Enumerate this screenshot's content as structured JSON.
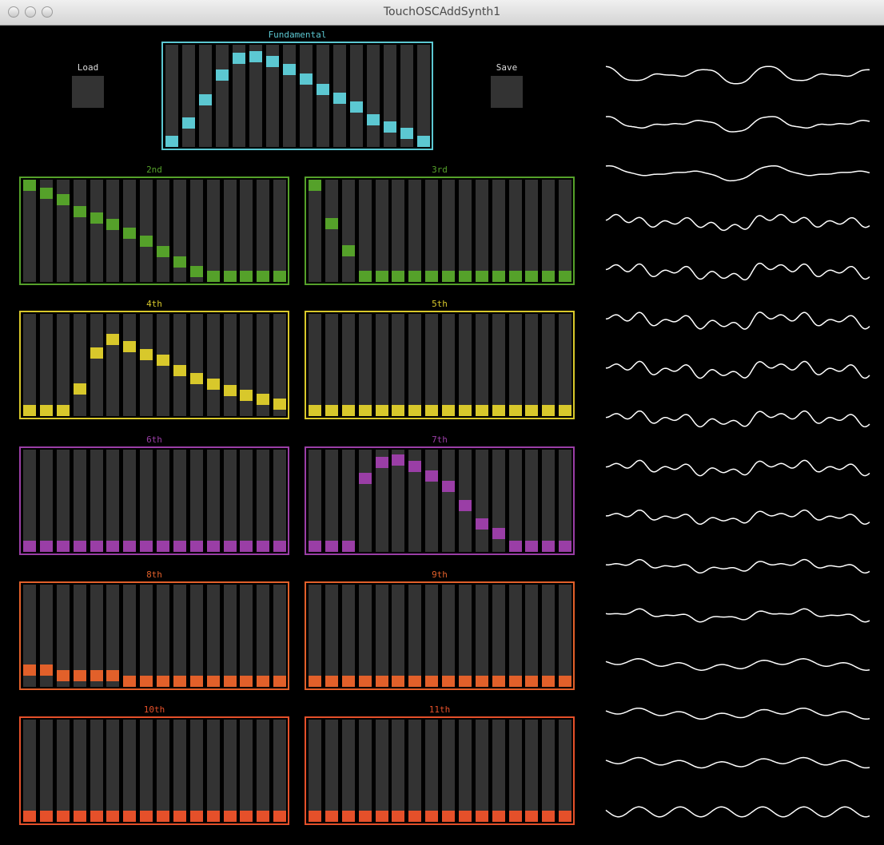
{
  "window": {
    "title": "TouchOSCAddSynth1"
  },
  "buttons": {
    "load_label": "Load",
    "save_label": "Save"
  },
  "colors": {
    "background": "#000000",
    "column": "#333333",
    "wave": "#ffffff",
    "fundamental": "#5cc8d2",
    "green": "#55a12a",
    "yellow": "#d8c82b",
    "purple": "#9a3ea6",
    "orange": "#e2602a",
    "red_orange": "#e5502a"
  },
  "harmonics": [
    {
      "key": "fundamental",
      "label": "Fundamental",
      "color": "#5cc8d2",
      "levels": [
        0.0,
        0.2,
        0.46,
        0.73,
        0.91,
        0.93,
        0.88,
        0.79,
        0.68,
        0.57,
        0.47,
        0.38,
        0.24,
        0.16,
        0.09,
        0.0
      ]
    },
    {
      "key": "2nd",
      "label": "2nd",
      "color": "#55a12a",
      "levels": [
        1.0,
        0.91,
        0.84,
        0.71,
        0.64,
        0.57,
        0.47,
        0.39,
        0.27,
        0.16,
        0.05,
        0.0,
        0.0,
        0.0,
        0.0,
        0.0
      ]
    },
    {
      "key": "3rd",
      "label": "3rd",
      "color": "#55a12a",
      "levels": [
        1.0,
        0.58,
        0.28,
        0.0,
        0.0,
        0.0,
        0.0,
        0.0,
        0.0,
        0.0,
        0.0,
        0.0,
        0.0,
        0.0,
        0.0,
        0.0
      ]
    },
    {
      "key": "4th",
      "label": "4th",
      "color": "#d8c82b",
      "levels": [
        0.0,
        0.0,
        0.0,
        0.24,
        0.63,
        0.78,
        0.7,
        0.61,
        0.55,
        0.44,
        0.35,
        0.29,
        0.22,
        0.17,
        0.12,
        0.07
      ]
    },
    {
      "key": "5th",
      "label": "5th",
      "color": "#d8c82b",
      "levels": [
        0.0,
        0.0,
        0.0,
        0.0,
        0.0,
        0.0,
        0.0,
        0.0,
        0.0,
        0.0,
        0.0,
        0.0,
        0.0,
        0.0,
        0.0,
        0.0
      ]
    },
    {
      "key": "6th",
      "label": "6th",
      "color": "#9a3ea6",
      "levels": [
        0.0,
        0.0,
        0.0,
        0.0,
        0.0,
        0.0,
        0.0,
        0.0,
        0.0,
        0.0,
        0.0,
        0.0,
        0.0,
        0.0,
        0.0,
        0.0
      ]
    },
    {
      "key": "7th",
      "label": "7th",
      "color": "#9a3ea6",
      "levels": [
        0.0,
        0.0,
        0.0,
        0.75,
        0.92,
        0.95,
        0.88,
        0.77,
        0.66,
        0.45,
        0.25,
        0.14,
        0.0,
        0.0,
        0.0,
        0.0
      ]
    },
    {
      "key": "8th",
      "label": "8th",
      "color": "#e2602a",
      "levels": [
        0.12,
        0.12,
        0.06,
        0.06,
        0.06,
        0.06,
        0.0,
        0.0,
        0.0,
        0.0,
        0.0,
        0.0,
        0.0,
        0.0,
        0.0,
        0.0
      ]
    },
    {
      "key": "9th",
      "label": "9th",
      "color": "#e2602a",
      "levels": [
        0.0,
        0.0,
        0.0,
        0.0,
        0.0,
        0.0,
        0.0,
        0.0,
        0.0,
        0.0,
        0.0,
        0.0,
        0.0,
        0.0,
        0.0,
        0.0
      ]
    },
    {
      "key": "10th",
      "label": "10th",
      "color": "#e5502a",
      "levels": [
        0.0,
        0.0,
        0.0,
        0.0,
        0.0,
        0.0,
        0.0,
        0.0,
        0.0,
        0.0,
        0.0,
        0.0,
        0.0,
        0.0,
        0.0,
        0.0
      ]
    },
    {
      "key": "11th",
      "label": "11th",
      "color": "#e5502a",
      "levels": [
        0.0,
        0.0,
        0.0,
        0.0,
        0.0,
        0.0,
        0.0,
        0.0,
        0.0,
        0.0,
        0.0,
        0.0,
        0.0,
        0.0,
        0.0,
        0.0
      ]
    }
  ]
}
